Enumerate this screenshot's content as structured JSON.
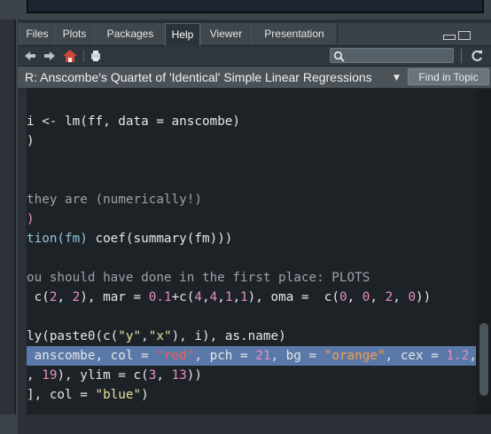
{
  "tabs": [
    {
      "label": "Files",
      "active": false
    },
    {
      "label": "Plots",
      "active": false
    },
    {
      "label": "Packages",
      "active": false
    },
    {
      "label": "Help",
      "active": true
    },
    {
      "label": "Viewer",
      "active": false
    },
    {
      "label": "Presentation",
      "active": false
    }
  ],
  "toolbar": {
    "back_icon": "arrow-left-icon",
    "forward_icon": "arrow-right-icon",
    "home_icon": "home-icon",
    "print_icon": "print-icon",
    "search_icon": "search-icon",
    "refresh_icon": "refresh-icon",
    "search_value": ""
  },
  "help": {
    "title": "R: Anscombe's Quartet of 'Identical' Simple Linear Regressions",
    "find_in_topic": "Find in Topic"
  },
  "code": {
    "line1_a": "i <- ",
    "line1_fn": "lm",
    "line1_b": "(ff, data = anscombe)",
    "line2": ")",
    "line3": "they are (numerically!)",
    "line4": ")",
    "line5_a": "tion(fm) ",
    "line5_b": "coef(summary(fm)))",
    "line6": "ou should have done in the first place: PLOTS",
    "line7_a": " c(",
    "line7_n1": "2",
    "line7_b": ", ",
    "line7_n2": "2",
    "line7_c": "), mar = ",
    "line7_n3": "0.1",
    "line7_d": "+c(",
    "line7_n4": "4",
    "line7_e": ",",
    "line7_n5": "4",
    "line7_f": ",",
    "line7_n6": "1",
    "line7_g": ",",
    "line7_n7": "1",
    "line7_h": "), oma =  c(",
    "line7_n8": "0",
    "line7_i": ", ",
    "line7_n9": "0",
    "line7_j": ", ",
    "line7_n10": "2",
    "line7_k": ", ",
    "line7_n11": "0",
    "line7_l": "))",
    "line8_a": "ly(paste0(c(",
    "line8_s1": "\"y\"",
    "line8_b": ",",
    "line8_s2": "\"x\"",
    "line8_c": "), i), as.name)",
    "line9_a": " anscombe, col = ",
    "line9_s1": "\"red\"",
    "line9_b": ", pch = ",
    "line9_n1": "21",
    "line9_c": ", bg = ",
    "line9_s2": "\"orange\"",
    "line9_d": ", cex = ",
    "line9_n2": "1.2",
    "line9_e": ",",
    "line10_a": ", ",
    "line10_n1": "19",
    "line10_b": "), ylim = c(",
    "line10_n2": "3",
    "line10_c": ", ",
    "line10_n3": "13",
    "line10_d": "))",
    "line11_a": "], col = ",
    "line11_s1": "\"blue\"",
    "line11_b": ")"
  }
}
